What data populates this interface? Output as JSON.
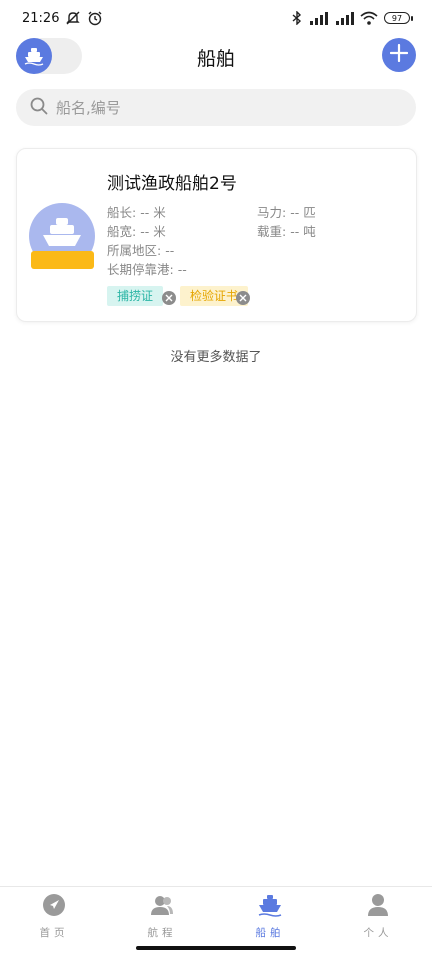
{
  "status_bar": {
    "time": "21:26",
    "battery": "97"
  },
  "header": {
    "title": "船舶"
  },
  "search": {
    "placeholder": "船名,编号",
    "value": ""
  },
  "card": {
    "name": "测试渔政船舶2号",
    "length_label": "船长:",
    "length_value": "-- 米",
    "power_label": "马力:",
    "power_value": "-- 匹",
    "width_label": "船宽:",
    "width_value": "-- 米",
    "load_label": "载重:",
    "load_value": "-- 吨",
    "region_label": "所属地区:",
    "region_value": "--",
    "port_label": "长期停靠港:",
    "port_value": "--",
    "tags": [
      "捕捞证",
      "检验证书"
    ]
  },
  "list_footer": "没有更多数据了",
  "bottom_nav": {
    "items": [
      {
        "label": "首页",
        "icon": "navigation-arrow-icon"
      },
      {
        "label": "航程",
        "icon": "people-icon"
      },
      {
        "label": "船舶",
        "icon": "ship-icon"
      },
      {
        "label": "个人",
        "icon": "person-icon"
      }
    ],
    "active_index": 2
  },
  "colors": {
    "accent": "#5b7ae0",
    "teal": "#2bb5a5",
    "yellow": "#fbb917"
  }
}
